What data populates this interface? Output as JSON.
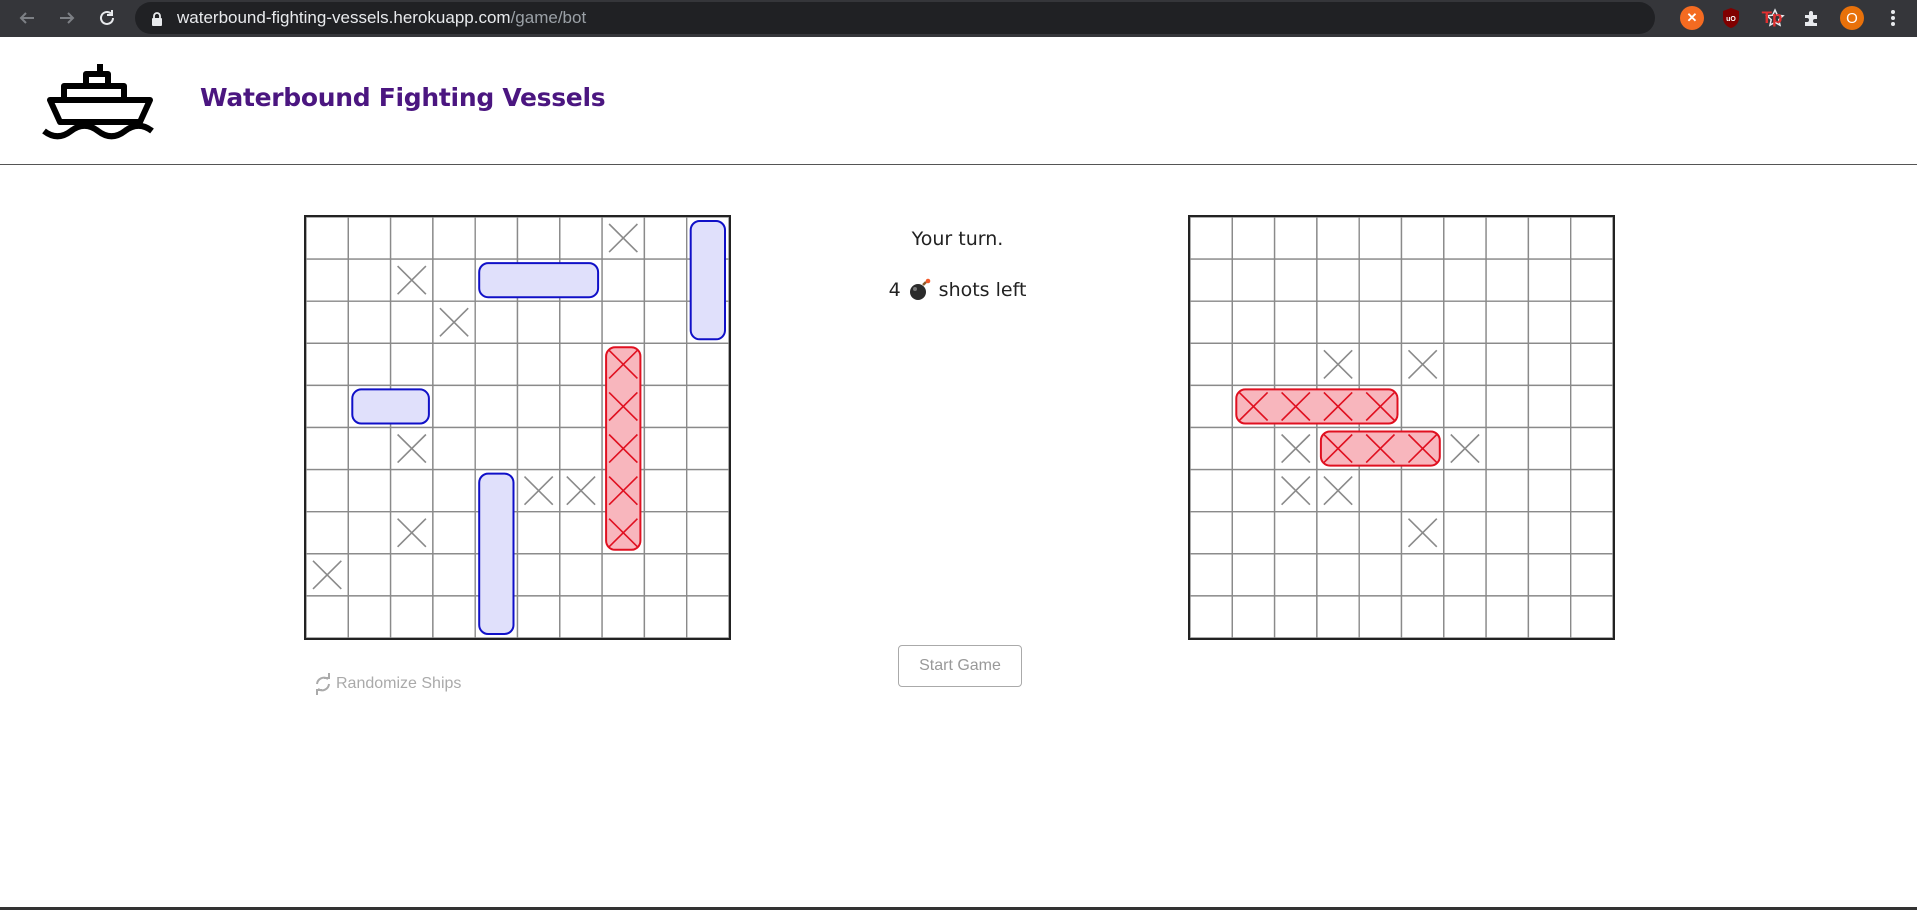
{
  "browser": {
    "url_domain": "waterbound-fighting-vessels.herokuapp.com",
    "url_path": "/game/bot",
    "profile_initial": "O",
    "colors": {
      "chrome": "#35363a",
      "omnibox": "#202124",
      "profile": "#e8710a"
    }
  },
  "header": {
    "title": "Waterbound Fighting Vessels",
    "logo_icon": "ship-icon",
    "title_color": "#4b1680"
  },
  "status": {
    "turn_text": "Your turn.",
    "shots_count": "4",
    "shots_icon": "bomb-icon",
    "shots_label": "shots left"
  },
  "controls": {
    "start_label": "Start Game",
    "randomize_label": "Randomize Ships",
    "randomize_icon": "refresh-icon"
  },
  "player_board": {
    "size": 10,
    "ships": [
      {
        "row": 1,
        "col": 4,
        "length": 3,
        "orientation": "horizontal",
        "state": "intact"
      },
      {
        "row": 0,
        "col": 9,
        "length": 3,
        "orientation": "vertical",
        "state": "intact"
      },
      {
        "row": 4,
        "col": 1,
        "length": 2,
        "orientation": "horizontal",
        "state": "intact"
      },
      {
        "row": 6,
        "col": 4,
        "length": 4,
        "orientation": "vertical",
        "state": "intact"
      },
      {
        "row": 3,
        "col": 7,
        "length": 5,
        "orientation": "vertical",
        "state": "sunk"
      }
    ],
    "misses": [
      [
        0,
        7
      ],
      [
        1,
        2
      ],
      [
        2,
        3
      ],
      [
        5,
        2
      ],
      [
        6,
        5
      ],
      [
        6,
        6
      ],
      [
        7,
        2
      ],
      [
        8,
        0
      ]
    ],
    "hits": [
      [
        3,
        7
      ],
      [
        4,
        7
      ],
      [
        5,
        7
      ],
      [
        6,
        7
      ],
      [
        7,
        7
      ]
    ]
  },
  "opponent_board": {
    "size": 10,
    "ships": [
      {
        "row": 4,
        "col": 1,
        "length": 4,
        "orientation": "horizontal",
        "state": "sunk"
      },
      {
        "row": 5,
        "col": 3,
        "length": 3,
        "orientation": "horizontal",
        "state": "sunk"
      }
    ],
    "misses": [
      [
        3,
        3
      ],
      [
        3,
        5
      ],
      [
        5,
        2
      ],
      [
        5,
        6
      ],
      [
        6,
        2
      ],
      [
        6,
        3
      ],
      [
        7,
        5
      ]
    ],
    "hits": [
      [
        4,
        1
      ],
      [
        4,
        2
      ],
      [
        4,
        3
      ],
      [
        4,
        4
      ],
      [
        5,
        3
      ],
      [
        5,
        4
      ],
      [
        5,
        5
      ]
    ]
  },
  "colors": {
    "ship_fill": "#e0e0fb",
    "ship_stroke": "#1010c8",
    "sunk_fill": "#f8b6bd",
    "sunk_stroke": "#e01020",
    "miss_stroke": "#8a8a8a",
    "grid": "#8a8a8a"
  }
}
